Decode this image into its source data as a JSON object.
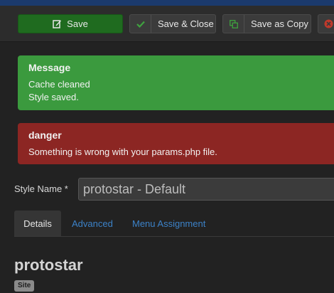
{
  "toolbar": {
    "save_label": "Save",
    "save_close_label": "Save & Close",
    "save_copy_label": "Save as Copy"
  },
  "messages": {
    "success": {
      "heading": "Message",
      "lines": [
        "Cache cleaned",
        "Style saved."
      ]
    },
    "danger": {
      "heading": "danger",
      "lines": [
        "Something is wrong with your params.php file."
      ]
    }
  },
  "form": {
    "style_name_label": "Style Name *",
    "style_name_value": "protostar - Default"
  },
  "tabs": [
    {
      "label": "Details",
      "active": true
    },
    {
      "label": "Advanced",
      "active": false
    },
    {
      "label": "Menu Assignment",
      "active": false
    }
  ],
  "template": {
    "name": "protostar",
    "badge": "Site"
  },
  "colors": {
    "toolbar_bg": "#2c2c2c",
    "success": "#3b9a3e",
    "danger": "#8c2623",
    "save_button": "#1f6b1f",
    "link": "#3c82c8"
  },
  "icons": {
    "save": "edit-icon",
    "save_close": "check-icon",
    "save_copy": "copy-icon",
    "cancel": "cancel-icon"
  }
}
